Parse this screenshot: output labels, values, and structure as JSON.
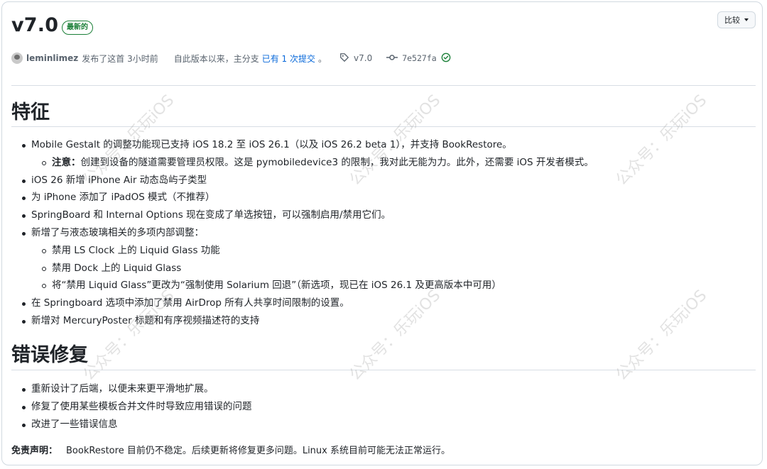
{
  "release": {
    "title": "v7.0",
    "latest_badge": "最新的",
    "compare_label": "比较"
  },
  "meta": {
    "author": "leminlimez",
    "published": "发布了这首 3小时前",
    "since_text": "自此版本以来，主分支",
    "commits_link": "已有 1 次提交",
    "period": "。",
    "tag": "v7.0",
    "commit_hash": "7e527fa"
  },
  "sections": {
    "features_heading": "特征",
    "features": [
      "Mobile Gestalt 的调整功能现已支持 iOS 18.2 至 iOS 26.1（以及 iOS 26.2 beta 1），并支持 BookRestore。",
      "iOS 26 新增 iPhone Air 动态岛屿子类型",
      "为 iPhone 添加了 iPadOS 模式（不推荐）",
      "SpringBoard 和 Internal Options 现在变成了单选按钮，可以强制启用/禁用它们。",
      "新增了与液态玻璃相关的多项内部调整：",
      "在 Springboard 选项中添加了禁用 AirDrop 所有人共享时间限制的设置。",
      "新增对 MercuryPoster 标题和有序视频描述符的支持"
    ],
    "feature_note_label": "注意：",
    "feature_note": "创建到设备的隧道需要管理员权限。这是 pymobiledevice3 的限制，我对此无能为力。此外，还需要 iOS 开发者模式。",
    "glass_subitems": [
      "禁用 LS Clock 上的 Liquid Glass 功能",
      "禁用 Dock 上的 Liquid Glass",
      "将“禁用 Liquid Glass”更改为“强制使用 Solarium 回退”（新选项，现已在 iOS 26.1 及更高版本中可用）"
    ],
    "bugfix_heading": "错误修复",
    "bugfixes": [
      "重新设计了后端，以便未来更平滑地扩展。",
      "修复了使用某些模板合并文件时导致应用错误的问题",
      "改进了一些错误信息"
    ],
    "disclaimer_label": "免责声明：",
    "disclaimer_text": "BookRestore 目前仍不稳定。后续更新将修复更多问题。Linux 系统目前可能无法正常运行。"
  },
  "watermark": {
    "text": "公众号：乐玩iOS"
  },
  "colors": {
    "success": "#1a7f37",
    "link": "#0969da",
    "muted": "#59636e"
  }
}
